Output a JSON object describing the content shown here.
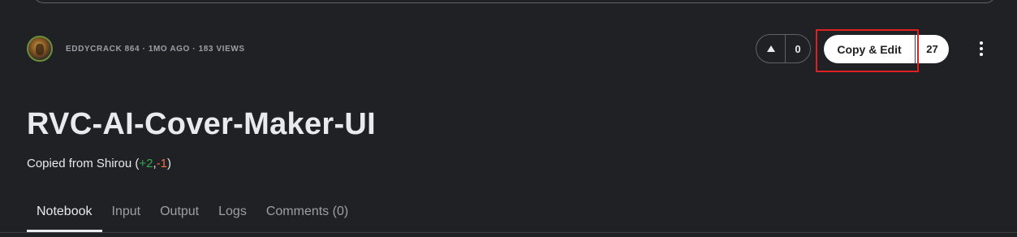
{
  "author": {
    "meta": "EDDYCRACK 864 · 1MO AGO · 183 VIEWS"
  },
  "vote": {
    "count": "0"
  },
  "copy_edit": {
    "label": "Copy & Edit",
    "count": "27"
  },
  "notebook": {
    "title": "RVC-AI-Cover-Maker-UI",
    "copied_prefix": "Copied from Shirou (",
    "plus": "+2",
    "comma": ",",
    "minus": "-1",
    "suffix": ")"
  },
  "tabs": [
    {
      "label": "Notebook"
    },
    {
      "label": "Input"
    },
    {
      "label": "Output"
    },
    {
      "label": "Logs"
    },
    {
      "label": "Comments (0)"
    }
  ],
  "colors": {
    "background": "#202124",
    "plus": "#34a853",
    "minus": "#ee6b4d",
    "highlight": "#e02020"
  },
  "icons": {
    "upvote": "triangle-up-icon",
    "more": "vertical-dots-icon"
  }
}
